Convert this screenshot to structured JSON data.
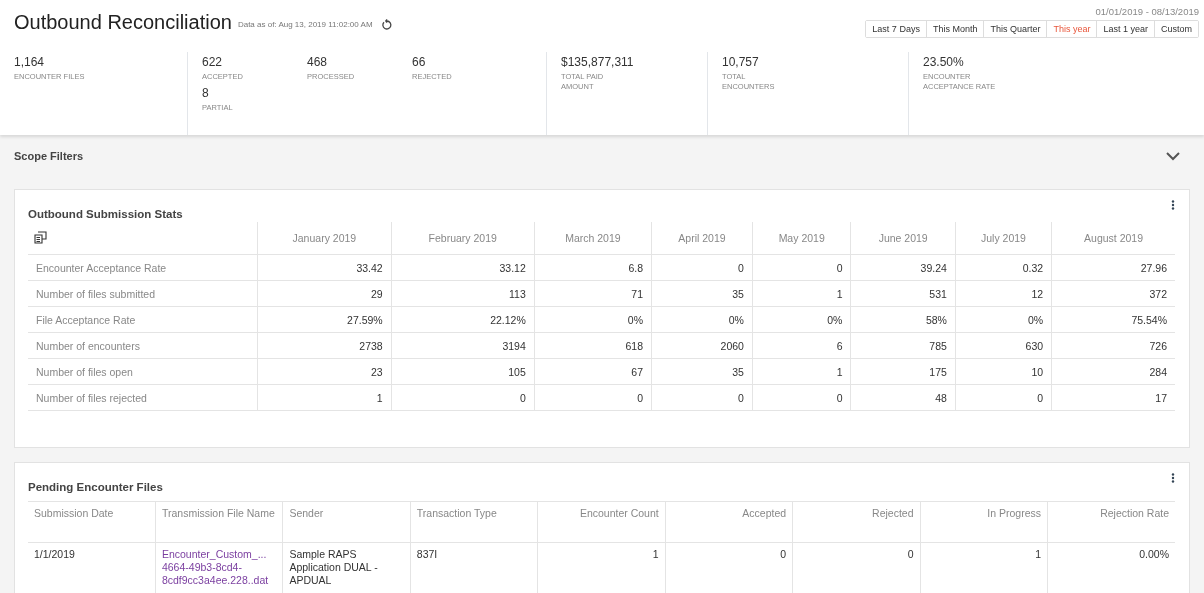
{
  "header": {
    "title": "Outbound Reconciliation",
    "data_as_of": "Data as of: Aug 13, 2019 11:02:00 AM",
    "date_range": "01/01/2019 - 08/13/2019",
    "range_tabs": [
      {
        "label": "Last 7 Days",
        "selected": false
      },
      {
        "label": "This Month",
        "selected": false
      },
      {
        "label": "This Quarter",
        "selected": false
      },
      {
        "label": "This year",
        "selected": true
      },
      {
        "label": "Last 1 year",
        "selected": false
      },
      {
        "label": "Custom",
        "selected": false
      }
    ]
  },
  "stat_groups": [
    {
      "stats": [
        {
          "value": "1,164",
          "label": "ENCOUNTER FILES"
        }
      ]
    },
    {
      "stats": [
        {
          "value": "622",
          "label": "ACCEPTED"
        },
        {
          "value": "468",
          "label": "PROCESSED"
        },
        {
          "value": "66",
          "label": "REJECTED"
        },
        {
          "value": "8",
          "label": "PARTIAL"
        }
      ]
    },
    {
      "stats": [
        {
          "value": "$135,877,311",
          "label": "TOTAL PAID AMOUNT"
        }
      ]
    },
    {
      "stats": [
        {
          "value": "10,757",
          "label": "TOTAL ENCOUNTERS"
        }
      ]
    },
    {
      "stats": [
        {
          "value": "23.50%",
          "label": "ENCOUNTER ACCEPTANCE RATE"
        }
      ]
    }
  ],
  "scope_filters": {
    "title": "Scope Filters",
    "expanded": false
  },
  "submission_stats": {
    "title": "Outbound Submission Stats",
    "columns": [
      "January 2019",
      "February 2019",
      "March 2019",
      "April 2019",
      "May 2019",
      "June 2019",
      "July 2019",
      "August 2019"
    ],
    "rows": [
      {
        "label": "Encounter Acceptance Rate",
        "values": [
          "33.42",
          "33.12",
          "6.8",
          "0",
          "0",
          "39.24",
          "0.32",
          "27.96"
        ]
      },
      {
        "label": "Number of files submitted",
        "values": [
          "29",
          "113",
          "71",
          "35",
          "1",
          "531",
          "12",
          "372"
        ]
      },
      {
        "label": "File Acceptance Rate",
        "values": [
          "27.59%",
          "22.12%",
          "0%",
          "0%",
          "0%",
          "58%",
          "0%",
          "75.54%"
        ]
      },
      {
        "label": "Number of encounters",
        "values": [
          "2738",
          "3194",
          "618",
          "2060",
          "6",
          "785",
          "630",
          "726"
        ]
      },
      {
        "label": "Number of files open",
        "values": [
          "23",
          "105",
          "67",
          "35",
          "1",
          "175",
          "10",
          "284"
        ]
      },
      {
        "label": "Number of files rejected",
        "values": [
          "1",
          "0",
          "0",
          "0",
          "0",
          "48",
          "0",
          "17"
        ]
      }
    ]
  },
  "pending_files": {
    "title": "Pending Encounter Files",
    "columns": [
      {
        "label": "Submission Date",
        "kind": "text"
      },
      {
        "label": "Transmission File Name",
        "kind": "link"
      },
      {
        "label": "Sender",
        "kind": "text"
      },
      {
        "label": "Transaction Type",
        "kind": "text"
      },
      {
        "label": "Encounter Count",
        "kind": "number"
      },
      {
        "label": "Accepted",
        "kind": "number"
      },
      {
        "label": "Rejected",
        "kind": "number"
      },
      {
        "label": "In Progress",
        "kind": "number"
      },
      {
        "label": "Rejection Rate",
        "kind": "number"
      }
    ],
    "rows": [
      {
        "cells": [
          "1/1/2019",
          "Encounter_Custom_... 4664-49b3-8cd4-8cdf9cc3a4ee.228..dat",
          "Sample RAPS Application DUAL - APDUAL",
          "837I",
          "1",
          "0",
          "0",
          "1",
          "0.00%"
        ]
      }
    ]
  }
}
